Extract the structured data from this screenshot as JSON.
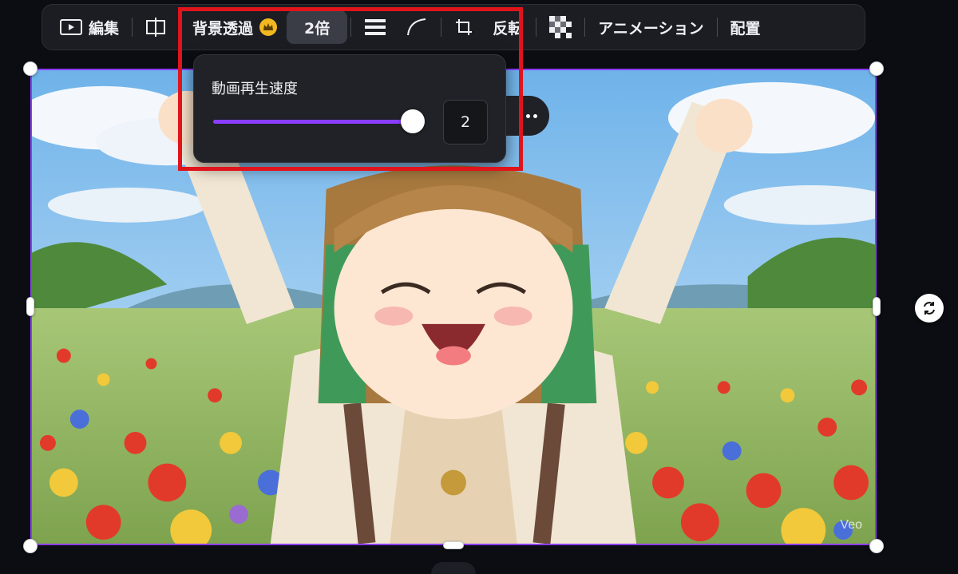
{
  "toolbar": {
    "edit_label": "編集",
    "bg_remove_label": "背景透過",
    "speed_label": "2倍",
    "flip_label": "反転",
    "animation_label": "アニメーション",
    "arrange_label": "配置",
    "icons": [
      "video-play-icon",
      "split-icon",
      "crown-icon",
      "lines-icon",
      "corner-curve-icon",
      "crop-icon",
      "transparency-checker-icon"
    ]
  },
  "popover": {
    "title": "動画再生速度",
    "speed_value": "2",
    "slider_fraction": 1.0
  },
  "canvas": {
    "watermark": "Veo"
  },
  "colors": {
    "accent": "#8b3dff",
    "highlight": "#e0141b",
    "toolbar_bg": "#1b1d23",
    "crown": "#f2b81f"
  }
}
